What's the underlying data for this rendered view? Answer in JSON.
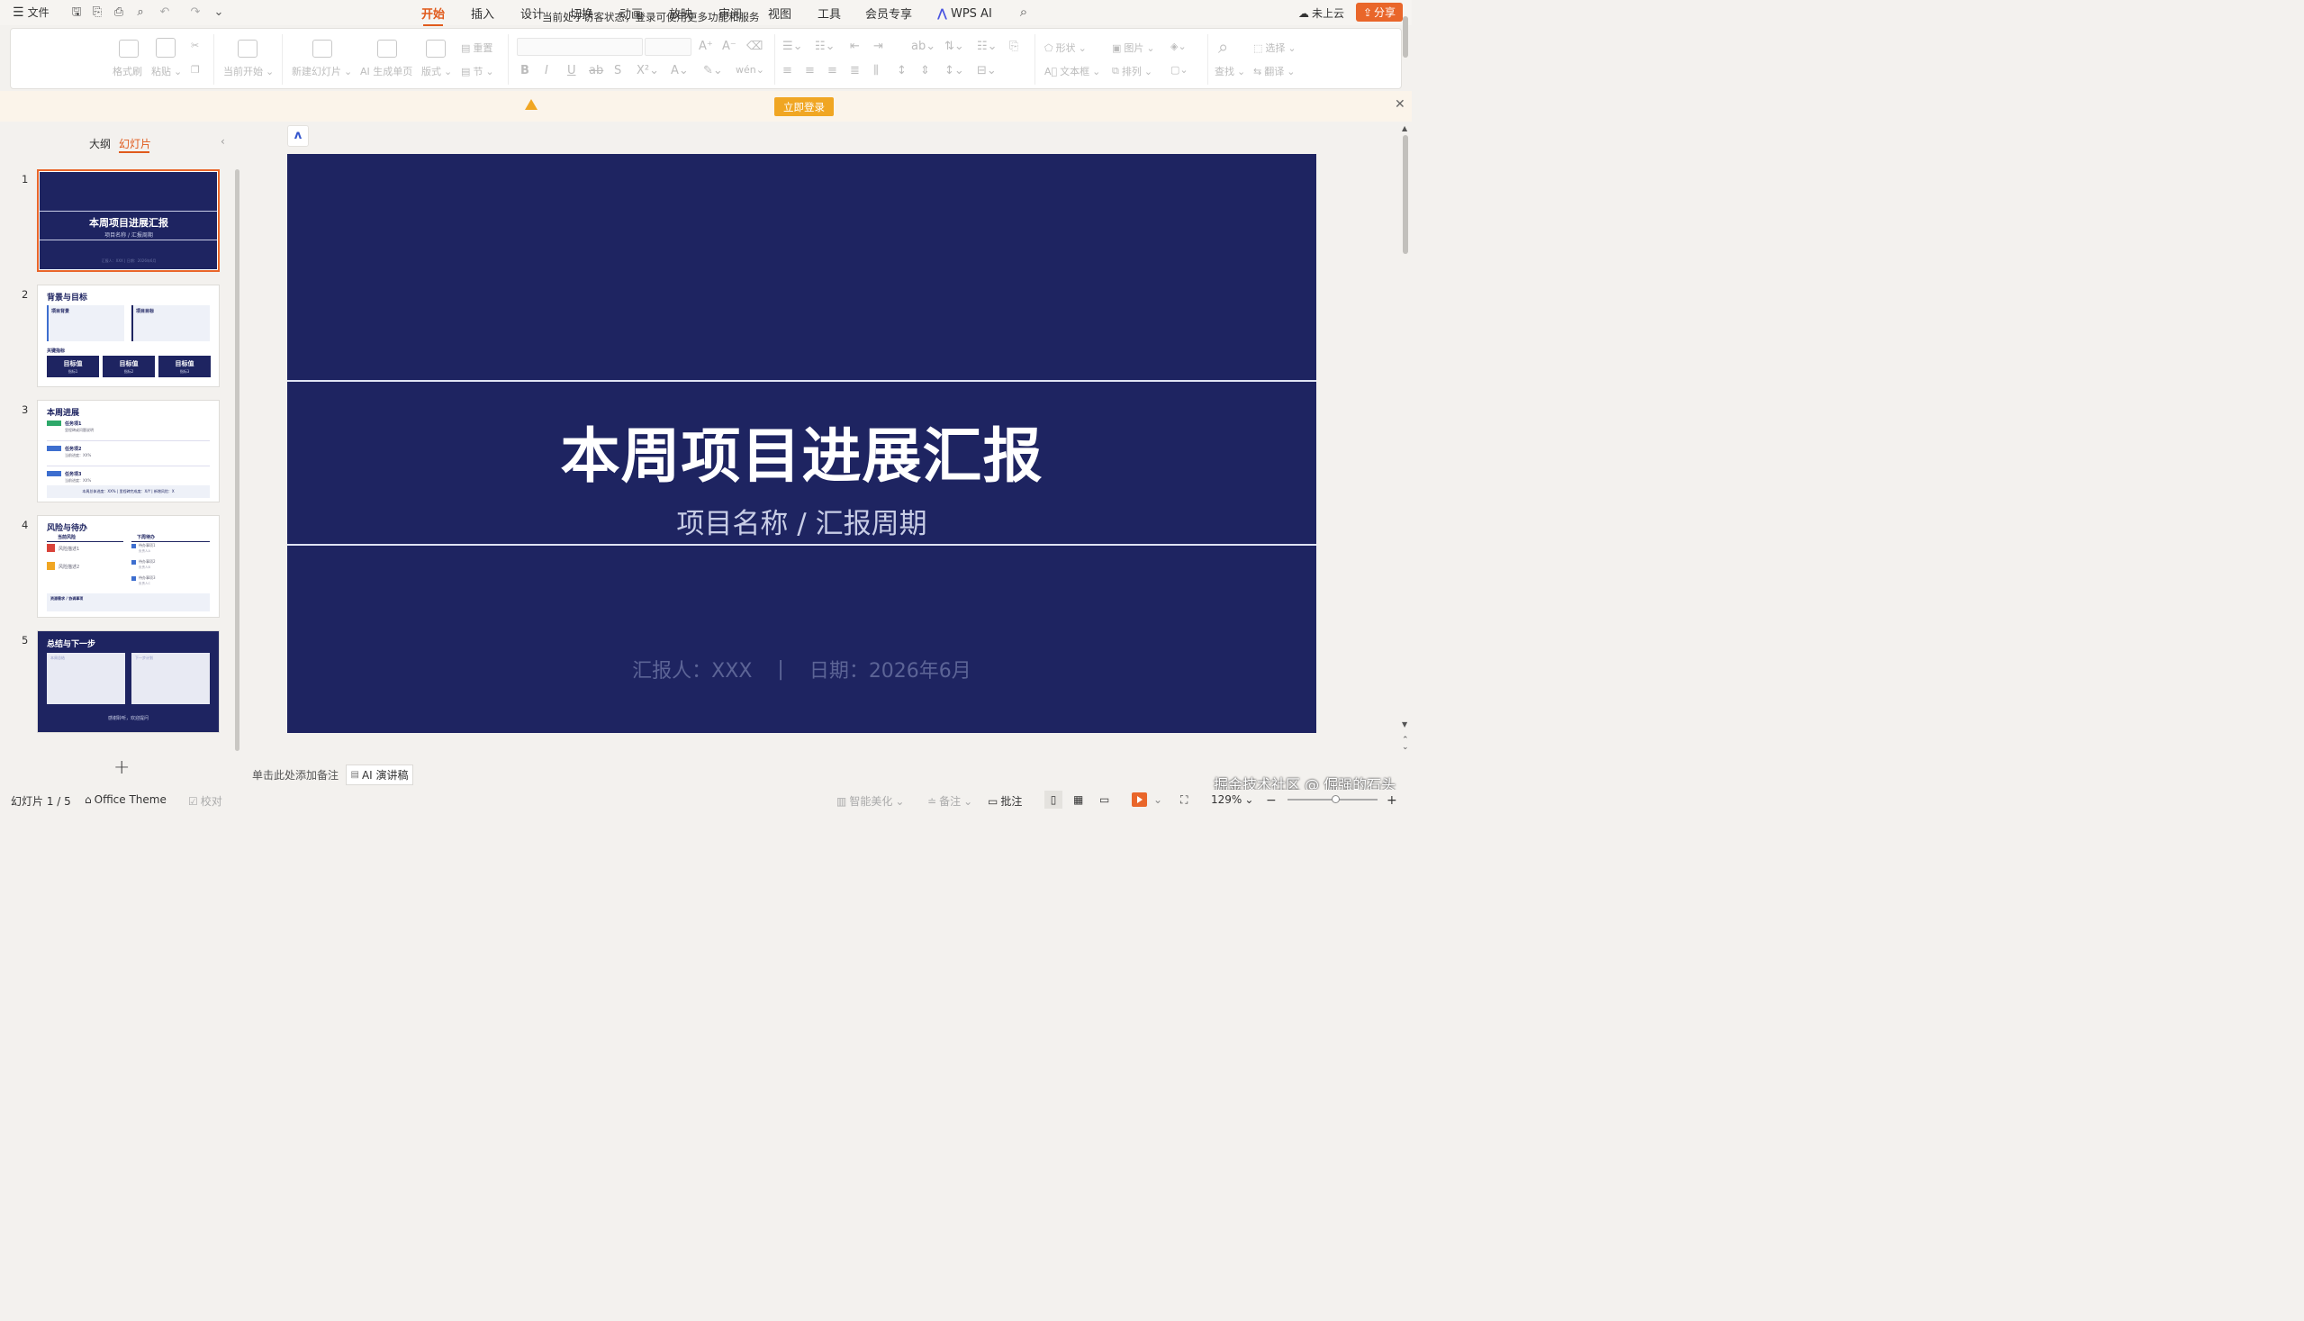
{
  "topbar": {
    "file_label": "文件",
    "tabs": [
      "开始",
      "插入",
      "设计",
      "切换",
      "动画",
      "放映",
      "审阅",
      "视图",
      "工具",
      "会员专享",
      "WPS AI"
    ],
    "active_tab": "开始",
    "cloud_label": "未上云",
    "share_label": "分享"
  },
  "ribbon": {
    "format_painter": "格式刷",
    "paste": "粘贴",
    "start_from_current": "当前开始",
    "new_slide": "新建幻灯片",
    "ai_single_page": "AI 生成单页",
    "layout": "版式",
    "reset": "重置",
    "section": "节",
    "shape": "形状",
    "picture": "图片",
    "textbox": "文本框",
    "arrange": "排列",
    "find": "查找",
    "select": "选择",
    "translate": "翻译"
  },
  "guest_bar": {
    "message": "当前处于访客状态，登录可使用更多功能和服务",
    "login_button": "立即登录"
  },
  "panel": {
    "tab_outline": "大纲",
    "tab_slides": "幻灯片",
    "active_tab": "幻灯片"
  },
  "thumbnails": [
    {
      "num": "1",
      "title": "本周项目进展汇报",
      "subtitle": "项目名称 / 汇报周期",
      "footer": "汇报人：XXX  |  日期：2026年6月"
    },
    {
      "num": "2",
      "title": "背景与目标",
      "left_head": "项目背景",
      "right_head": "项目目标",
      "key_label": "关键指标",
      "kpi": [
        "目标值",
        "目标值",
        "目标值"
      ],
      "kpi_sub": [
        "指标1",
        "指标2",
        "指标3"
      ]
    },
    {
      "num": "3",
      "title": "本周进展",
      "tasks": [
        "任务项1",
        "任务项2",
        "任务项3"
      ],
      "task_notes": [
        "里程碑或问题说明",
        "当前进度：XX%",
        "当前进度：XX%"
      ],
      "footer": "本周总体进度：XX%  |  里程碑完成度：X/Y  |  新增风险：X"
    },
    {
      "num": "4",
      "title": "风险与待办",
      "risk_head": "当前风险",
      "todo_head": "下周待办",
      "risks": [
        "风险描述1",
        "风险描述2"
      ],
      "todos": [
        "待办事项1",
        "待办事项2",
        "待办事项3"
      ],
      "todo_owner": [
        "负责人A",
        "负责人B",
        "负责人C"
      ],
      "support": "资源需求 / 协调事项"
    },
    {
      "num": "5",
      "title": "总结与下一步",
      "left_head": "本周总结",
      "right_head": "下一步计划",
      "closing": "感谢聆听，欢迎提问"
    }
  ],
  "slide": {
    "title": "本周项目进展汇报",
    "subtitle": "项目名称 / 汇报周期",
    "reporter": "汇报人：XXX",
    "separator": "|",
    "date": "日期：2026年6月"
  },
  "notes": {
    "placeholder": "单击此处添加备注",
    "ai_speech": "AI 演讲稿"
  },
  "watermark": "掘金技术社区 @ 倔强的石头_",
  "status": {
    "slide_counter": "幻灯片 1 / 5",
    "theme": "Office Theme",
    "proofread": "校对",
    "smart_beautify": "智能美化",
    "notes": "备注",
    "comments": "批注",
    "zoom": "129%"
  },
  "colors": {
    "accent": "#e9662a",
    "slide_bg": "#1e2461",
    "warning": "#f0a623"
  }
}
